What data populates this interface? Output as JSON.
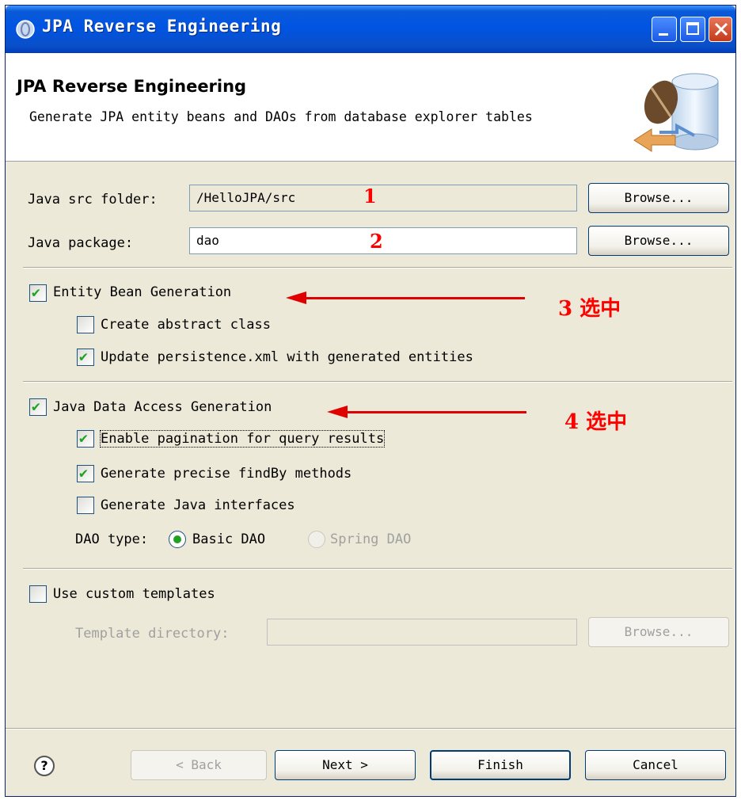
{
  "window": {
    "title": "JPA Reverse Engineering"
  },
  "banner": {
    "title": "JPA Reverse Engineering",
    "description": "Generate JPA entity beans and DAOs from database explorer tables"
  },
  "fields": {
    "src_folder_label": "Java src folder:",
    "src_folder_value": "/HelloJPA/src",
    "package_label": "Java package:",
    "package_value": "dao",
    "browse_label": "Browse..."
  },
  "entity": {
    "label": "Entity Bean Generation",
    "checked": true,
    "abstract_label": "Create abstract class",
    "abstract_checked": false,
    "persistence_label": "Update persistence.xml with generated entities",
    "persistence_checked": true
  },
  "dao": {
    "label": "Java Data Access Generation",
    "checked": true,
    "pagination_label": "Enable pagination for query results",
    "pagination_checked": true,
    "findby_label": "Generate precise findBy methods",
    "findby_checked": true,
    "interfaces_label": "Generate Java interfaces",
    "interfaces_checked": false,
    "type_label": "DAO type:",
    "basic_label": "Basic DAO",
    "spring_label": "Spring DAO",
    "selected": "Basic DAO"
  },
  "templates": {
    "label": "Use custom templates",
    "checked": false,
    "dir_label": "Template directory:",
    "dir_value": "",
    "browse_label": "Browse..."
  },
  "annotations": {
    "n1": "1",
    "n2": "2",
    "n3": "3 选中",
    "n4": "4 选中"
  },
  "footer": {
    "back": "< Back",
    "next": "Next >",
    "finish": "Finish",
    "cancel": "Cancel",
    "help": "?"
  },
  "colors": {
    "title_blue": "#0054e3",
    "check_green": "#21a121",
    "annotation_red": "#ff0000"
  }
}
